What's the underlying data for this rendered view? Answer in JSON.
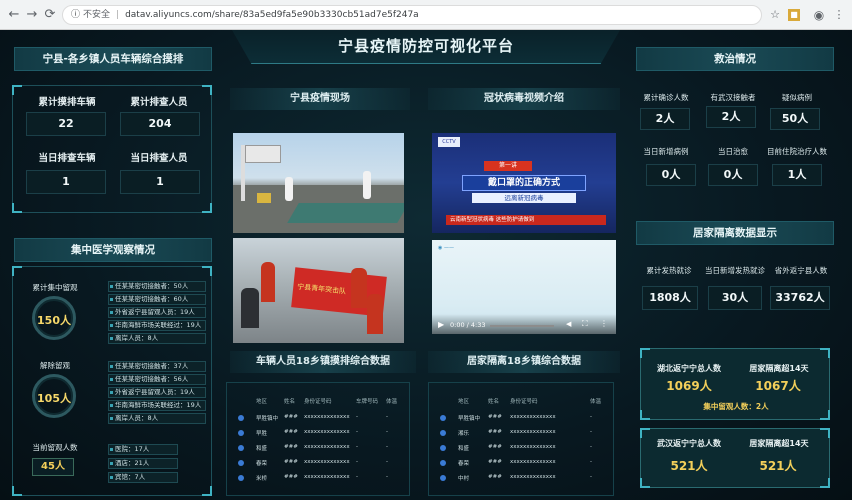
{
  "browser": {
    "insecure_label": "不安全",
    "url": "datav.aliyuncs.com/share/83a5ed9fa5e90b3330cb51ad7e5f247a"
  },
  "title": "宁县疫情防控可视化平台",
  "left": {
    "screening": {
      "header": "宁县-各乡镇人员车辆综合摸排",
      "labels": [
        "累计摸排车辆",
        "累计排查人员",
        "当日排查车辆",
        "当日排查人员"
      ],
      "values": [
        "22",
        "204",
        "1",
        "1"
      ]
    },
    "observation": {
      "header": "集中医学观察情况",
      "group1": {
        "label": "累计集中留观",
        "value": "150人",
        "rows": [
          "任某某密切接触者：50人",
          "任某某密切接触者：60人",
          "外省返宁县留观人员：19人",
          "华南海鲜市场关联经过：19人",
          "离岸人员：8人"
        ]
      },
      "group2": {
        "label": "解除留观",
        "value": "105人",
        "rows": [
          "任某某密切接触者：37人",
          "任某某密切接触者：56人",
          "外省返宁县留观人员：19人",
          "华南海鲜市场关联经过：19人",
          "离岸人员：8人"
        ]
      },
      "group3": {
        "label": "当前留观人数",
        "value": "45人",
        "rows": [
          "医院：17人",
          "酒店：21人",
          "宾馆：7人"
        ]
      }
    }
  },
  "middle": {
    "scene_header": "宁县疫情现场",
    "video_header": "冠状病毒视频介绍",
    "video_banner_lines": [
      "第一讲",
      "戴口罩的正确方式",
      "远离新冠病毒",
      "云南新型冠状病毒 这些防护请做到"
    ],
    "video_time": "0:00 / 4:33",
    "photo_banner": "宁县青年突击队",
    "table1_header": "车辆人员18乡镇摸排综合数据",
    "table2_header": "居家隔离18乡镇综合数据",
    "table1_columns": [
      "地区",
      "姓名",
      "身份证号码",
      "车牌号码",
      "体温"
    ],
    "table2_columns": [
      "地区",
      "姓名",
      "身份证号码",
      "体温"
    ],
    "table1_rows": [
      [
        "早胜镇中",
        "###",
        "xxxxxxxxxxxxxx",
        "-",
        "-"
      ],
      [
        "早胜",
        "###",
        "xxxxxxxxxxxxxx",
        "-",
        "-"
      ],
      [
        "和盛",
        "###",
        "xxxxxxxxxxxxxx",
        "-",
        "-"
      ],
      [
        "春荣",
        "###",
        "xxxxxxxxxxxxxx",
        "-",
        "-"
      ],
      [
        "米桥",
        "###",
        "xxxxxxxxxxxxxx",
        "-",
        "-"
      ]
    ],
    "table2_rows": [
      [
        "早胜镇中",
        "###",
        "xxxxxxxxxxxxxx",
        "-"
      ],
      [
        "湘乐",
        "###",
        "xxxxxxxxxxxxxx",
        "-"
      ],
      [
        "和盛",
        "###",
        "xxxxxxxxxxxxxx",
        "-"
      ],
      [
        "春荣",
        "###",
        "xxxxxxxxxxxxxx",
        "-"
      ],
      [
        "中村",
        "###",
        "xxxxxxxxxxxxxx",
        "-"
      ]
    ]
  },
  "right": {
    "treatment": {
      "header": "救治情况",
      "labels": [
        "累计确诊人数",
        "有武汉接触者",
        "疑似病例",
        "当日新增病例",
        "当日治愈",
        "目前住院治疗人数"
      ],
      "values": [
        "2人",
        "2人",
        "50人",
        "0人",
        "0人",
        "1人"
      ]
    },
    "home": {
      "header": "居家隔离数据显示",
      "labels": [
        "累计发热就诊",
        "当日新增发热就诊",
        "省外返宁县人数"
      ],
      "values": [
        "1808人",
        "30人",
        "33762人"
      ]
    },
    "hubei": {
      "labels": [
        "湖北返宁宁总人数",
        "居家隔离超14天"
      ],
      "values": [
        "1069人",
        "1067人"
      ],
      "note": "集中留观人数：2人"
    },
    "wuhan": {
      "labels": [
        "武汉返宁宁总人数",
        "居家隔离超14天"
      ],
      "values": [
        "521人",
        "521人"
      ]
    }
  },
  "colors": {
    "accent": "#3fb3c3",
    "highlight": "#f3cf5a",
    "background": "#071318"
  }
}
